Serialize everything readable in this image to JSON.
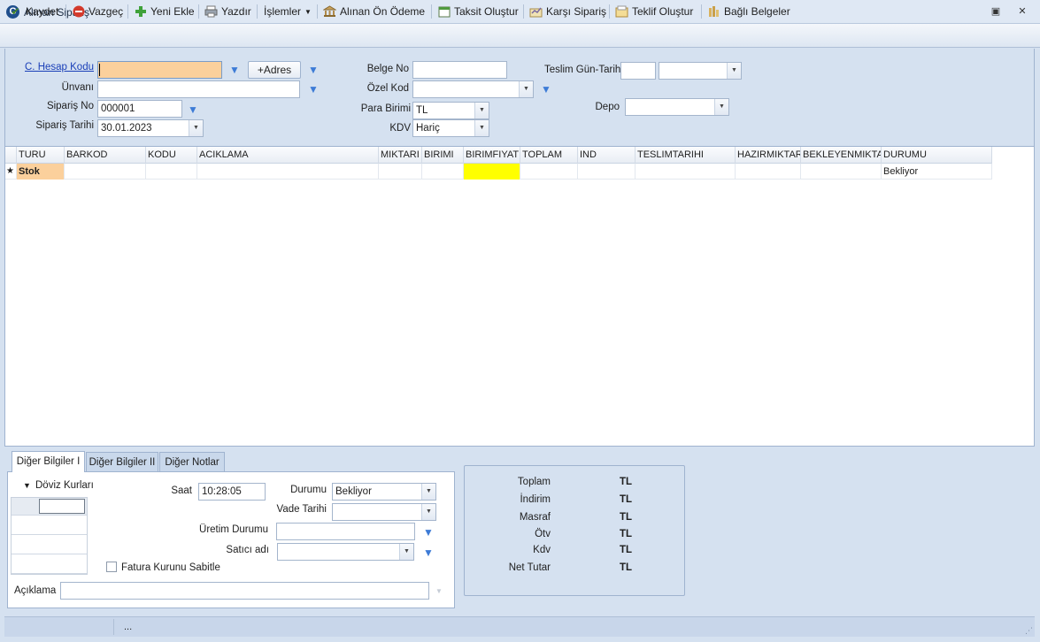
{
  "window": {
    "title": "Alınan Sipariş",
    "logo_letter": "C"
  },
  "toolbar": {
    "kaydet": "Kaydet",
    "vazgec": "Vazgeç",
    "yeni_ekle": "Yeni Ekle",
    "yazdir": "Yazdır",
    "islemler": "İşlemler",
    "alinan_on_odeme": "Alınan Ön Ödeme",
    "taksit_olustur": "Taksit Oluştur",
    "karsi_siparis": "Karşı Sipariş",
    "teklif_olustur": "Teklif Oluştur",
    "bagli_belgeler": "Bağlı Belgeler"
  },
  "header": {
    "cari_hesap_kodu_label": "C. Hesap Kodu",
    "cari_hesap_kodu_value": "",
    "adres_button": "+Adres",
    "unvan_label": "Ünvanı",
    "unvan_value": "",
    "siparis_no_label": "Sipariş No",
    "siparis_no_value": "000001",
    "siparis_tarihi_label": "Sipariş Tarihi",
    "siparis_tarihi_value": "30.01.2023",
    "belge_no_label": "Belge No",
    "belge_no_value": "",
    "ozel_kod_label": "Özel Kod",
    "ozel_kod_value": "",
    "para_birimi_label": "Para Birimi",
    "para_birimi_value": "TL",
    "kdv_label": "KDV",
    "kdv_value": "Hariç",
    "teslim_label": "Teslim Gün-Tarihi",
    "teslim_gun_value": "",
    "teslim_tarih_value": "",
    "depo_label": "Depo",
    "depo_value": ""
  },
  "grid": {
    "columns": [
      "TURU",
      "BARKOD",
      "KODU",
      "ACIKLAMA",
      "MIKTARI",
      "BIRIMI",
      "BIRIMFIYAT",
      "TOPLAM",
      "IND",
      "TESLIMTARIHI",
      "HAZIRMIKTAR",
      "BEKLEYENMIKTAR",
      "DURUMU"
    ],
    "new_row_marker": "★",
    "rows": [
      {
        "turu": "Stok",
        "barkod": "",
        "kodu": "",
        "aciklama": "",
        "miktari": "",
        "birimi": "",
        "birimfiyat": "",
        "toplam": "",
        "ind": "",
        "teslimtarihi": "",
        "hazirmiktar": "",
        "bekleyenmiktar": "",
        "durumu": "Bekliyor"
      }
    ]
  },
  "tabs": [
    "Diğer Bilgiler I",
    "Diğer Bilgiler II",
    "Diğer Notlar"
  ],
  "diger_bilgiler": {
    "doviz_kurlari_label": "Döviz Kurları",
    "saat_label": "Saat",
    "saat_value": "10:28:05",
    "durumu_label": "Durumu",
    "durumu_value": "Bekliyor",
    "vade_tarihi_label": "Vade Tarihi",
    "vade_tarihi_value": "",
    "uretim_durumu_label": "Üretim Durumu",
    "uretim_durumu_value": "",
    "satici_adi_label": "Satıcı adı",
    "satici_adi_value": "",
    "fatura_kurunu_sabitle_label": "Fatura Kurunu Sabitle",
    "fatura_kurunu_sabitle_checked": false,
    "aciklama_label": "Açıklama",
    "aciklama_value": ""
  },
  "totals": {
    "rows": [
      {
        "label": "Toplam",
        "value": "TL"
      },
      {
        "label": "İndirim",
        "value": "TL"
      },
      {
        "label": "Masraf",
        "value": "TL"
      },
      {
        "label": "Ötv",
        "value": "TL"
      },
      {
        "label": "Kdv",
        "value": "TL"
      },
      {
        "label": "Net Tutar",
        "value": "TL"
      }
    ]
  },
  "statusbar": {
    "text": "..."
  },
  "colors": {
    "active_field": "#fbd09c",
    "price_cell": "#ffff00",
    "background": "#d5e1f0",
    "link": "#1a3fb8"
  }
}
